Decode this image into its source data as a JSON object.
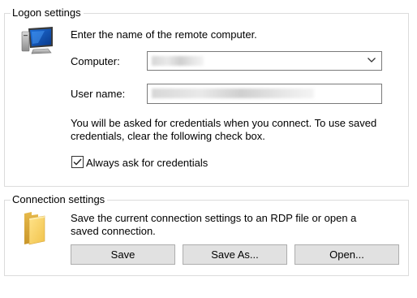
{
  "logon": {
    "title": "Logon settings",
    "instruction": "Enter the name of the remote computer.",
    "computer_label": "Computer:",
    "computer_value": "",
    "username_label": "User name:",
    "username_value": "",
    "credentials_note_line1": "You will be asked for credentials when you connect. To use saved",
    "credentials_note_line2": "credentials, clear the following check box.",
    "always_ask_label": "Always ask for credentials",
    "always_ask_checked": true,
    "icon": "remote-computer-icon"
  },
  "connection": {
    "title": "Connection settings",
    "description_line1": "Save the current connection settings to an RDP file or open a",
    "description_line2": "saved connection.",
    "save_label": "Save",
    "save_as_label": "Save As...",
    "open_label": "Open...",
    "icon": "folder-icon"
  },
  "colors": {
    "group_border": "#dcdcdc",
    "button_face": "#e1e1e1",
    "button_border": "#adadad",
    "field_border": "#7a7a7a"
  }
}
